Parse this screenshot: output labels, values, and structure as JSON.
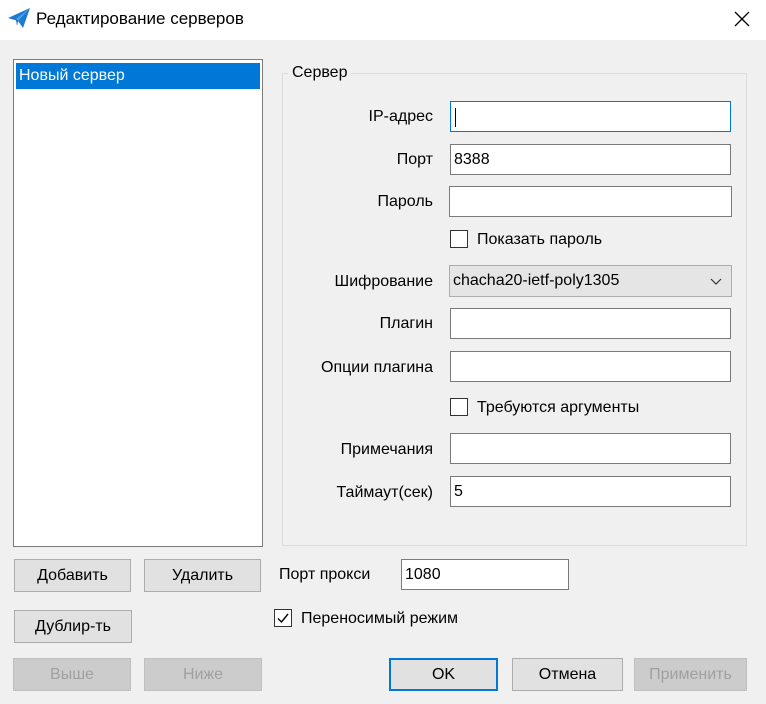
{
  "window": {
    "title": "Редактирование серверов",
    "close_glyph": "✕",
    "icon": "paper-plane-icon"
  },
  "servers": {
    "items": [
      {
        "label": "Новый сервер",
        "selected": true
      }
    ]
  },
  "server_group": {
    "title": "Сервер",
    "ip": {
      "label": "IP-адрес",
      "value": ""
    },
    "port": {
      "label": "Порт",
      "value": "8388"
    },
    "password": {
      "label": "Пароль",
      "value": ""
    },
    "show_password": {
      "label": "Показать пароль",
      "checked": false
    },
    "encryption": {
      "label": "Шифрование",
      "value": "chacha20-ietf-poly1305"
    },
    "plugin": {
      "label": "Плагин",
      "value": ""
    },
    "plugin_options": {
      "label": "Опции плагина",
      "value": ""
    },
    "requires_args": {
      "label": "Требуются аргументы",
      "checked": false
    },
    "remarks": {
      "label": "Примечания",
      "value": ""
    },
    "timeout": {
      "label": "Таймаут(сек)",
      "value": "5"
    }
  },
  "buttons": {
    "add": "Добавить",
    "delete": "Удалить",
    "duplicate": "Дублир-ть",
    "up": "Выше",
    "down": "Ниже",
    "ok": "OK",
    "cancel": "Отмена",
    "apply": "Применить"
  },
  "proxy": {
    "port_label": "Порт прокси",
    "port_value": "1080"
  },
  "portable": {
    "label": "Переносимый режим",
    "checked": true
  },
  "colors": {
    "selection": "#0078d7",
    "focus_border": "#0078d7",
    "background": "#f0f0f0"
  }
}
